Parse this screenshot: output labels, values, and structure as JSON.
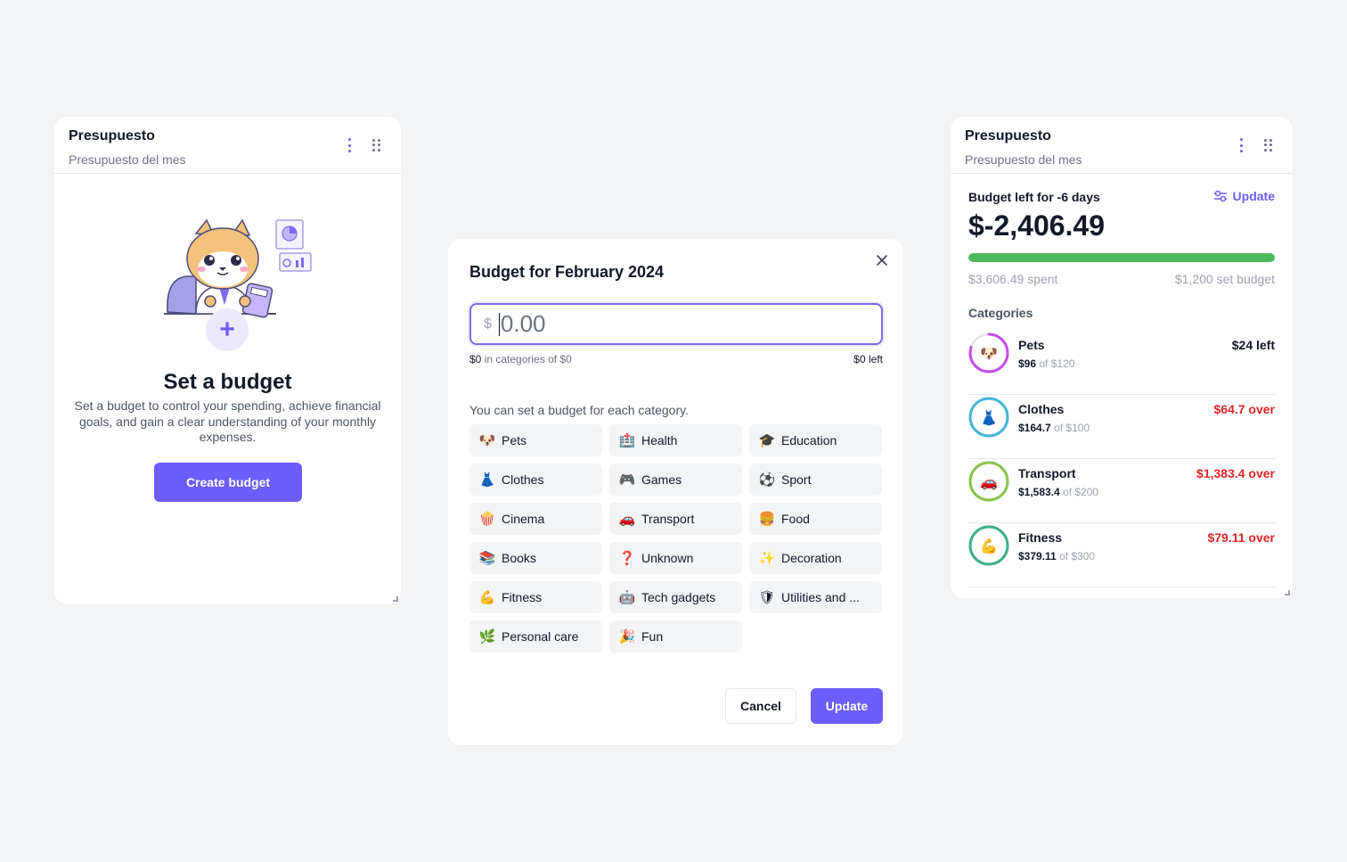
{
  "left_card": {
    "title": "Presupuesto",
    "subtitle": "Presupuesto del mes",
    "empty_title": "Set a budget",
    "empty_desc": "Set a budget to control your spending, achieve financial goals, and gain a clear understanding of your monthly expenses.",
    "create_label": "Create budget",
    "plus": "+"
  },
  "modal": {
    "title": "Budget for February 2024",
    "currency": "$",
    "amount_placeholder": "0.00",
    "allocated": "$0",
    "allocated_text": "in categories of $0",
    "left": "$0 left",
    "prompt": "You can set a budget for each category.",
    "categories": [
      {
        "emoji": "🐶",
        "label": "Pets"
      },
      {
        "emoji": "🏥",
        "label": "Health"
      },
      {
        "emoji": "🎓",
        "label": "Education"
      },
      {
        "emoji": "👗",
        "label": "Clothes"
      },
      {
        "emoji": "🎮",
        "label": "Games"
      },
      {
        "emoji": "⚽",
        "label": "Sport"
      },
      {
        "emoji": "🍿",
        "label": "Cinema"
      },
      {
        "emoji": "🚗",
        "label": "Transport"
      },
      {
        "emoji": "🍔",
        "label": "Food"
      },
      {
        "emoji": "📚",
        "label": "Books"
      },
      {
        "emoji": "❓",
        "label": "Unknown"
      },
      {
        "emoji": "✨",
        "label": "Decoration"
      },
      {
        "emoji": "💪",
        "label": "Fitness"
      },
      {
        "emoji": "🤖",
        "label": "Tech gadgets"
      },
      {
        "emoji": "🛡",
        "label": "Utilities and ..."
      },
      {
        "emoji": "🌿",
        "label": "Personal care"
      },
      {
        "emoji": "🎉",
        "label": "Fun"
      }
    ],
    "cancel_label": "Cancel",
    "update_label": "Update"
  },
  "right_card": {
    "title": "Presupuesto",
    "subtitle": "Presupuesto del mes",
    "budget_left_label": "Budget left for -6 days",
    "update_label": "Update",
    "amount": "$-2,406.49",
    "progress_fraction": 1.0,
    "spent": "$3,606.49 spent",
    "set_budget": "$1,200 set budget",
    "categories_label": "Categories",
    "colors": {
      "accent": "#6d5dfc",
      "success": "#4cbb5b",
      "danger": "#dc2626"
    },
    "categories": [
      {
        "emoji": "🐶",
        "name": "Pets",
        "spent": "$96",
        "of": "of $120",
        "status": "$24 left",
        "over": false,
        "ring_color": "#c44ee8",
        "fraction": 0.8
      },
      {
        "emoji": "👗",
        "name": "Clothes",
        "spent": "$164.7",
        "of": "of $100",
        "status": "$64.7 over",
        "over": true,
        "ring_color": "#45b5d6",
        "fraction": 1.0
      },
      {
        "emoji": "🚗",
        "name": "Transport",
        "spent": "$1,583.4",
        "of": "of $200",
        "status": "$1,383.4 over",
        "over": true,
        "ring_color": "#8bc34a",
        "fraction": 1.0
      },
      {
        "emoji": "💪",
        "name": "Fitness",
        "spent": "$379.11",
        "of": "of $300",
        "status": "$79.11 over",
        "over": true,
        "ring_color": "#3fae8c",
        "fraction": 1.0
      }
    ]
  }
}
